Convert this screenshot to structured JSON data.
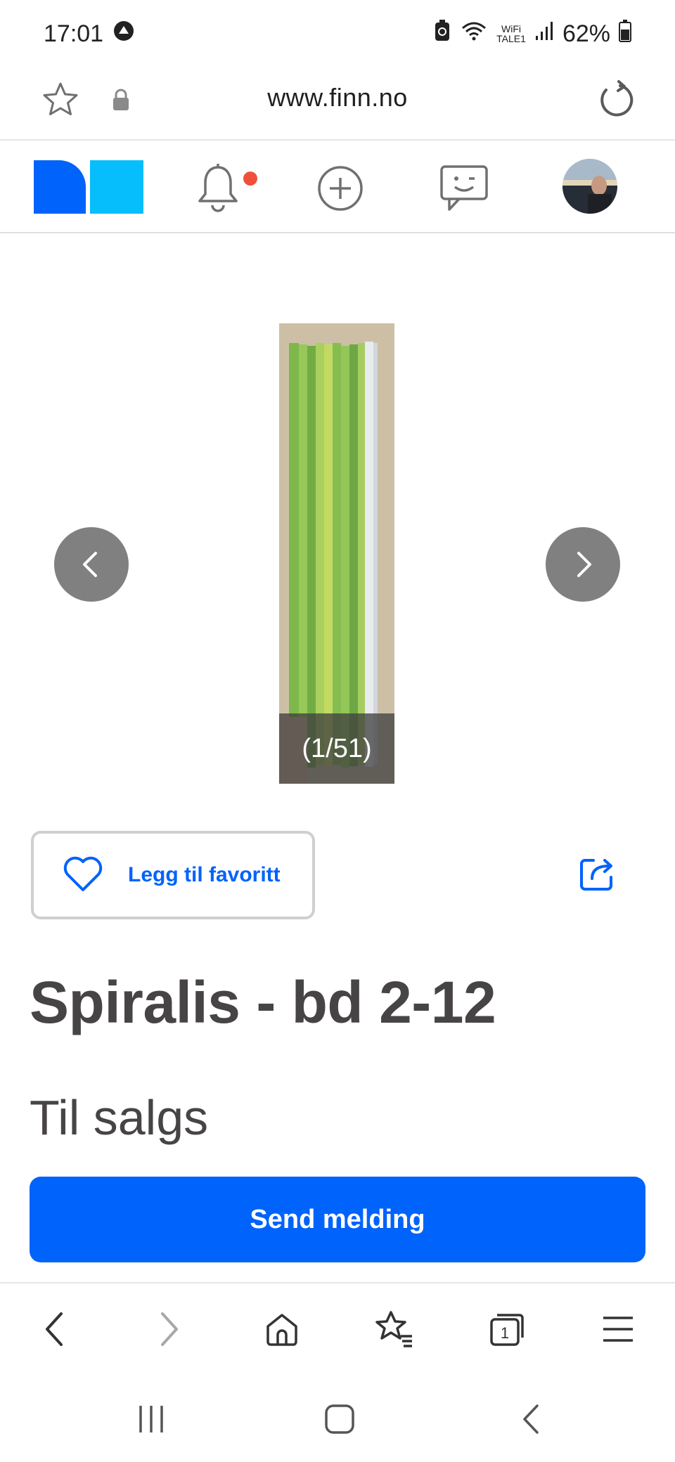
{
  "status_bar": {
    "time": "17:01",
    "wifi_label_top": "WiFi",
    "wifi_label_bottom": "TALE1",
    "battery": "62%"
  },
  "browser": {
    "url": "www.finn.no"
  },
  "listing": {
    "image_counter": "(1/51)",
    "favorite_label": "Legg til favoritt",
    "title": "Spiralis - bd 2-12",
    "status": "Til salgs",
    "send_message_label": "Send melding"
  },
  "colors": {
    "brand_blue": "#0063fb",
    "logo_dark_blue": "#0063fb",
    "logo_light_blue": "#06befb",
    "notification_dot": "#f0503b",
    "text": "#474445"
  },
  "icons": {
    "header": [
      "bell-icon",
      "plus-circle-icon",
      "chat-icon",
      "avatar"
    ],
    "toolbar": [
      "back-icon",
      "forward-icon",
      "home-icon",
      "bookmarks-icon",
      "tabs-icon",
      "menu-icon"
    ],
    "system": [
      "recents-icon",
      "home-system-icon",
      "back-system-icon"
    ]
  }
}
